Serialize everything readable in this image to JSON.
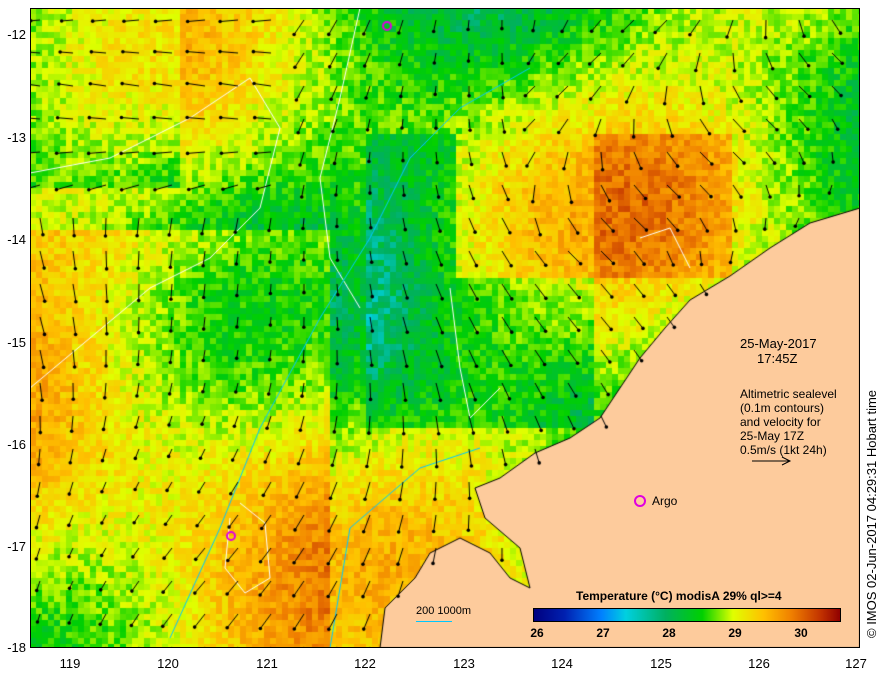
{
  "map": {
    "x_ticks": [
      "119",
      "120",
      "121",
      "122",
      "123",
      "124",
      "125",
      "126",
      "127"
    ],
    "y_ticks": [
      "-12",
      "-13",
      "-14",
      "-15",
      "-16",
      "-17",
      "-18"
    ],
    "date": "25-May-2017",
    "time": "17:45Z",
    "altimetry_note": [
      "Altimetric sealevel",
      "(0.1m contours)",
      "and velocity for",
      "25-May 17Z",
      "0.5m/s (1kt 24h)"
    ],
    "argo_label": "Argo",
    "scale_label": "200  1000m",
    "colorbar": {
      "title": "Temperature (°C) modisA 29% ql>=4",
      "ticks": [
        "26",
        "27",
        "28",
        "29",
        "30"
      ]
    },
    "credit": "© IMOS 02-Jun-2017 04:29:31 Hobart time",
    "colors": {
      "land": "#fdcb9c",
      "argo": "#e000e0",
      "isobath": "#00c8ff"
    }
  }
}
